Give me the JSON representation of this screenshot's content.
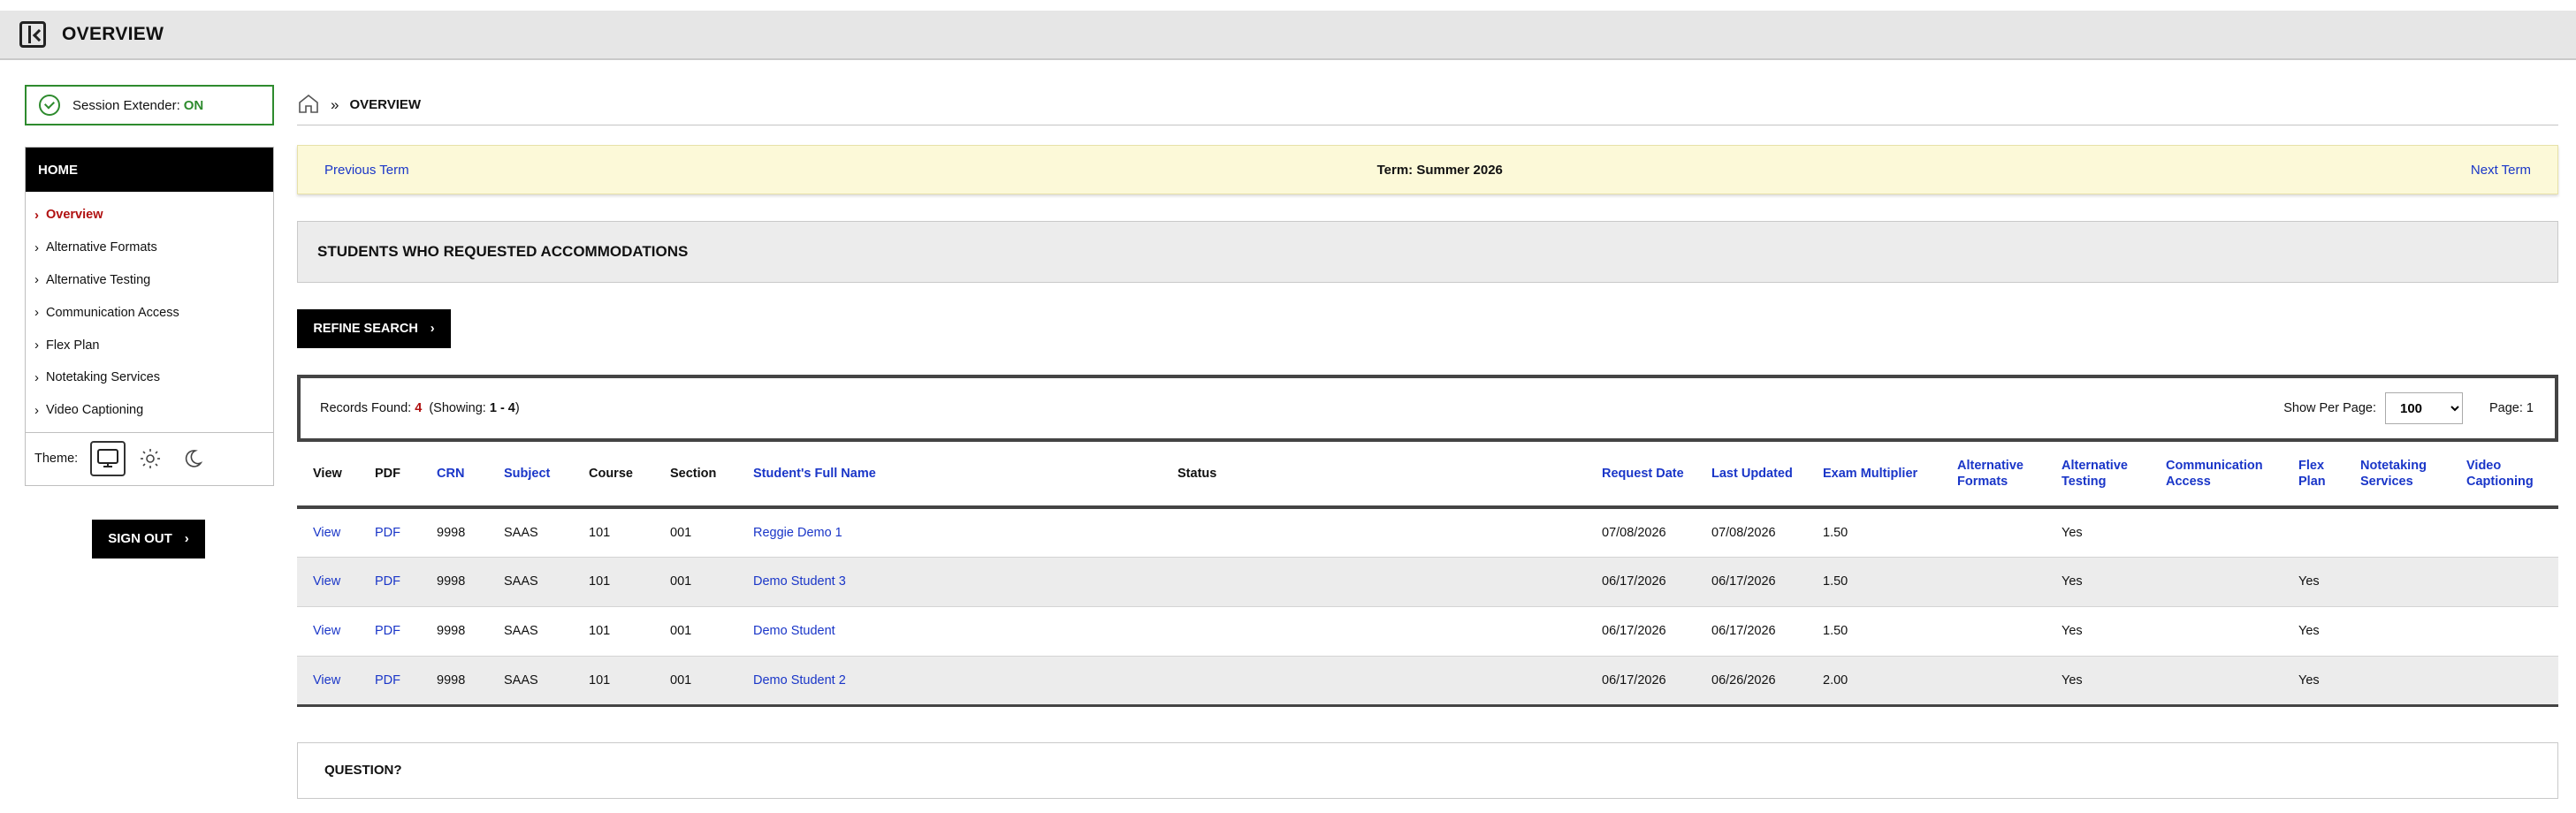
{
  "header": {
    "title": "OVERVIEW"
  },
  "sidebar": {
    "session_label": "Session Extender:",
    "session_state": "ON",
    "home_label": "HOME",
    "items": [
      {
        "label": "Overview",
        "active": true
      },
      {
        "label": "Alternative Formats"
      },
      {
        "label": "Alternative Testing"
      },
      {
        "label": "Communication Access"
      },
      {
        "label": "Flex Plan"
      },
      {
        "label": "Notetaking Services"
      },
      {
        "label": "Video Captioning"
      }
    ],
    "theme_label": "Theme:",
    "signout_label": "SIGN OUT"
  },
  "breadcrumb": {
    "separator": "»",
    "current": "OVERVIEW"
  },
  "term": {
    "prev": "Previous Term",
    "current": "Term: Summer 2026",
    "next": "Next Term"
  },
  "section_title": "STUDENTS WHO REQUESTED ACCOMMODATIONS",
  "refine_label": "REFINE SEARCH",
  "records": {
    "found_label": "Records Found:",
    "count": "4",
    "showing_prefix": "(Showing:",
    "showing_range": "1 - 4",
    "showing_suffix": ")",
    "per_page_label": "Show Per Page:",
    "per_page_value": "100",
    "page_label": "Page: 1"
  },
  "table": {
    "columns": [
      "View",
      "PDF",
      "CRN",
      "Subject",
      "Course",
      "Section",
      "Student's Full Name",
      "Status",
      "Request Date",
      "Last Updated",
      "Exam Multiplier",
      "Alternative Formats",
      "Alternative Testing",
      "Communication Access",
      "Flex Plan",
      "Notetaking Services",
      "Video Captioning"
    ],
    "rows": [
      {
        "view": "View",
        "pdf": "PDF",
        "crn": "9998",
        "subject": "SAAS",
        "course": "101",
        "section": "001",
        "name": "Reggie Demo 1",
        "status": "",
        "request_date": "07/08/2026",
        "last_updated": "07/08/2026",
        "exam_multiplier": "1.50",
        "alt_formats": "",
        "alt_testing": "Yes",
        "comm_access": "",
        "flex_plan": "",
        "notetaking": "",
        "video_captioning": ""
      },
      {
        "view": "View",
        "pdf": "PDF",
        "crn": "9998",
        "subject": "SAAS",
        "course": "101",
        "section": "001",
        "name": "Demo Student 3",
        "status": "",
        "request_date": "06/17/2026",
        "last_updated": "06/17/2026",
        "exam_multiplier": "1.50",
        "alt_formats": "",
        "alt_testing": "Yes",
        "comm_access": "",
        "flex_plan": "Yes",
        "notetaking": "",
        "video_captioning": ""
      },
      {
        "view": "View",
        "pdf": "PDF",
        "crn": "9998",
        "subject": "SAAS",
        "course": "101",
        "section": "001",
        "name": "Demo Student",
        "status": "",
        "request_date": "06/17/2026",
        "last_updated": "06/17/2026",
        "exam_multiplier": "1.50",
        "alt_formats": "",
        "alt_testing": "Yes",
        "comm_access": "",
        "flex_plan": "Yes",
        "notetaking": "",
        "video_captioning": ""
      },
      {
        "view": "View",
        "pdf": "PDF",
        "crn": "9998",
        "subject": "SAAS",
        "course": "101",
        "section": "001",
        "name": "Demo Student 2",
        "status": "",
        "request_date": "06/17/2026",
        "last_updated": "06/26/2026",
        "exam_multiplier": "2.00",
        "alt_formats": "",
        "alt_testing": "Yes",
        "comm_access": "",
        "flex_plan": "Yes",
        "notetaking": "",
        "video_captioning": ""
      }
    ]
  },
  "question_title": "QUESTION?"
}
